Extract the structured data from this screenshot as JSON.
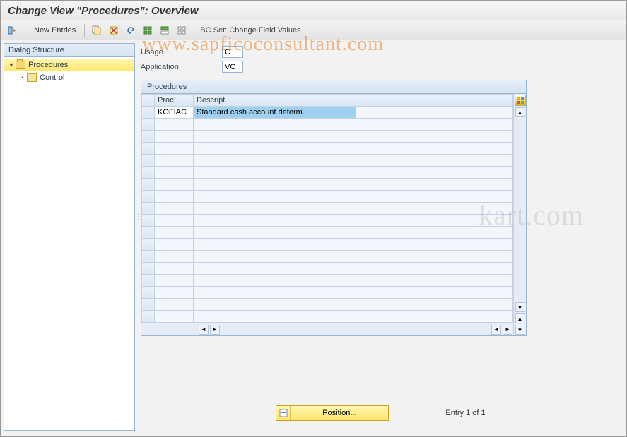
{
  "title": "Change View \"Procedures\": Overview",
  "toolbar": {
    "new_entries": "New Entries",
    "bcset_label": "BC Set: Change Field Values"
  },
  "sidebar": {
    "title": "Dialog Structure",
    "nodes": [
      {
        "label": "Procedures",
        "selected": true,
        "open": true
      },
      {
        "label": "Control",
        "selected": false,
        "open": false
      }
    ]
  },
  "fields": {
    "usage": {
      "label": "Usage",
      "value": "C"
    },
    "application": {
      "label": "Application",
      "value": "VC"
    }
  },
  "grid": {
    "title": "Procedures",
    "columns": [
      "Proc...",
      "Descript."
    ],
    "rows": [
      {
        "proc": "KOFIAC",
        "desc": "Standard cash account determ.",
        "selected": true
      }
    ],
    "empty_rows": 17
  },
  "footer": {
    "position_btn": "Position...",
    "entry_status": "Entry 1 of 1"
  },
  "watermarks": {
    "top": "www.sapficoconsultant.com",
    "mid": "kart.com"
  }
}
